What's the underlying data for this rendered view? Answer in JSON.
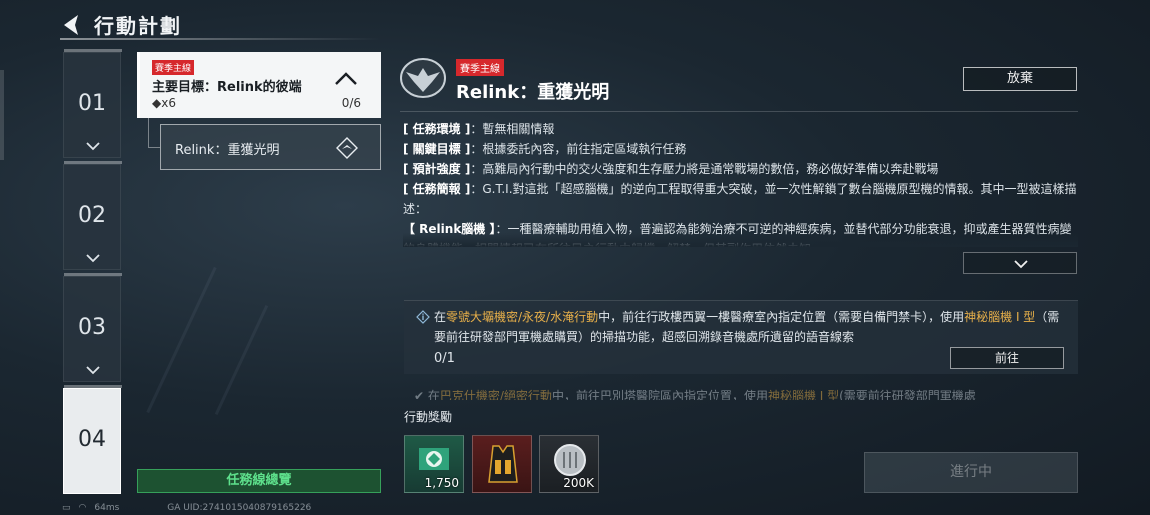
{
  "header": {
    "title": "行動計劃"
  },
  "chapters": [
    {
      "num": "01",
      "active": false
    },
    {
      "num": "02",
      "active": false
    },
    {
      "num": "03",
      "active": false
    },
    {
      "num": "04",
      "active": true
    }
  ],
  "objective": {
    "tag": "賽季主線",
    "title": "主要目標：Relink的彼端",
    "count": "◆x6",
    "progress": "0/6",
    "sub_label": "Relink：重獲光明"
  },
  "overview_button": "任務線總覽",
  "detail": {
    "tag": "賽季主線",
    "title": "Relink：重獲光明",
    "abandon_label": "放棄",
    "info": [
      {
        "key": "[ 任務環境 ]",
        "value": "：暫無相關情報"
      },
      {
        "key": "[ 關鍵目標 ]",
        "value": "：根據委託內容，前往指定區域執行任務"
      },
      {
        "key": "[ 預計強度 ]",
        "value": "：高難局內行動中的交火強度和生存壓力將是通常戰場的數倍，務必做好準備以奔赴戰場"
      },
      {
        "key": "[ 任務簡報 ]",
        "value": "：G.T.I.對這批「超感腦機」的逆向工程取得重大突破，並一次性解鎖了數台腦機原型機的情報。其中一型被這樣描述："
      },
      {
        "key": "【 Relink腦機 】",
        "value": "：一種醫療輔助用植入物，普遍認為能夠治療不可逆的神經疾病，並替代部分功能衰退，抑或產生器質性病變的身體機能。相關情報已在所往目之行動中歸檔，解禁，但其副作用依然未知"
      }
    ]
  },
  "task": {
    "desc_prefix": "在",
    "desc_hl1": "零號大壩機密/永夜/水淹行動",
    "desc_mid": "中，前往行政樓西翼一樓醫療室內指定位置（需要自備門禁卡），使用",
    "desc_hl2": "神秘腦機 I 型",
    "desc_suffix": "（需要前往研發部門軍機處購買）的掃描功能，超感回溯錄音機處所遺留的語音線索",
    "progress": "0/1",
    "go_label": "前往"
  },
  "next_task": {
    "prefix": "在",
    "hl1": "巴克什機密/絕密行動",
    "mid": "中，前往巴別塔醫院區內指定位置，使用",
    "hl2": "神秘腦機 I 型",
    "suffix": "(需要前往研發部門軍機處"
  },
  "rewards": {
    "title": "行動獎勵",
    "items": [
      {
        "icon": "badge-icon",
        "amount": "1,750"
      },
      {
        "icon": "armor-vest-icon",
        "amount": ""
      },
      {
        "icon": "coin-icon",
        "amount": "200K"
      }
    ]
  },
  "in_progress_label": "進行中",
  "status": {
    "ping": "64ms",
    "uid": "GA UID:2741015040879165226"
  },
  "colors": {
    "accent_red": "#d6282c",
    "highlight": "#e8b04a",
    "overview_green": "#5ee08c"
  }
}
